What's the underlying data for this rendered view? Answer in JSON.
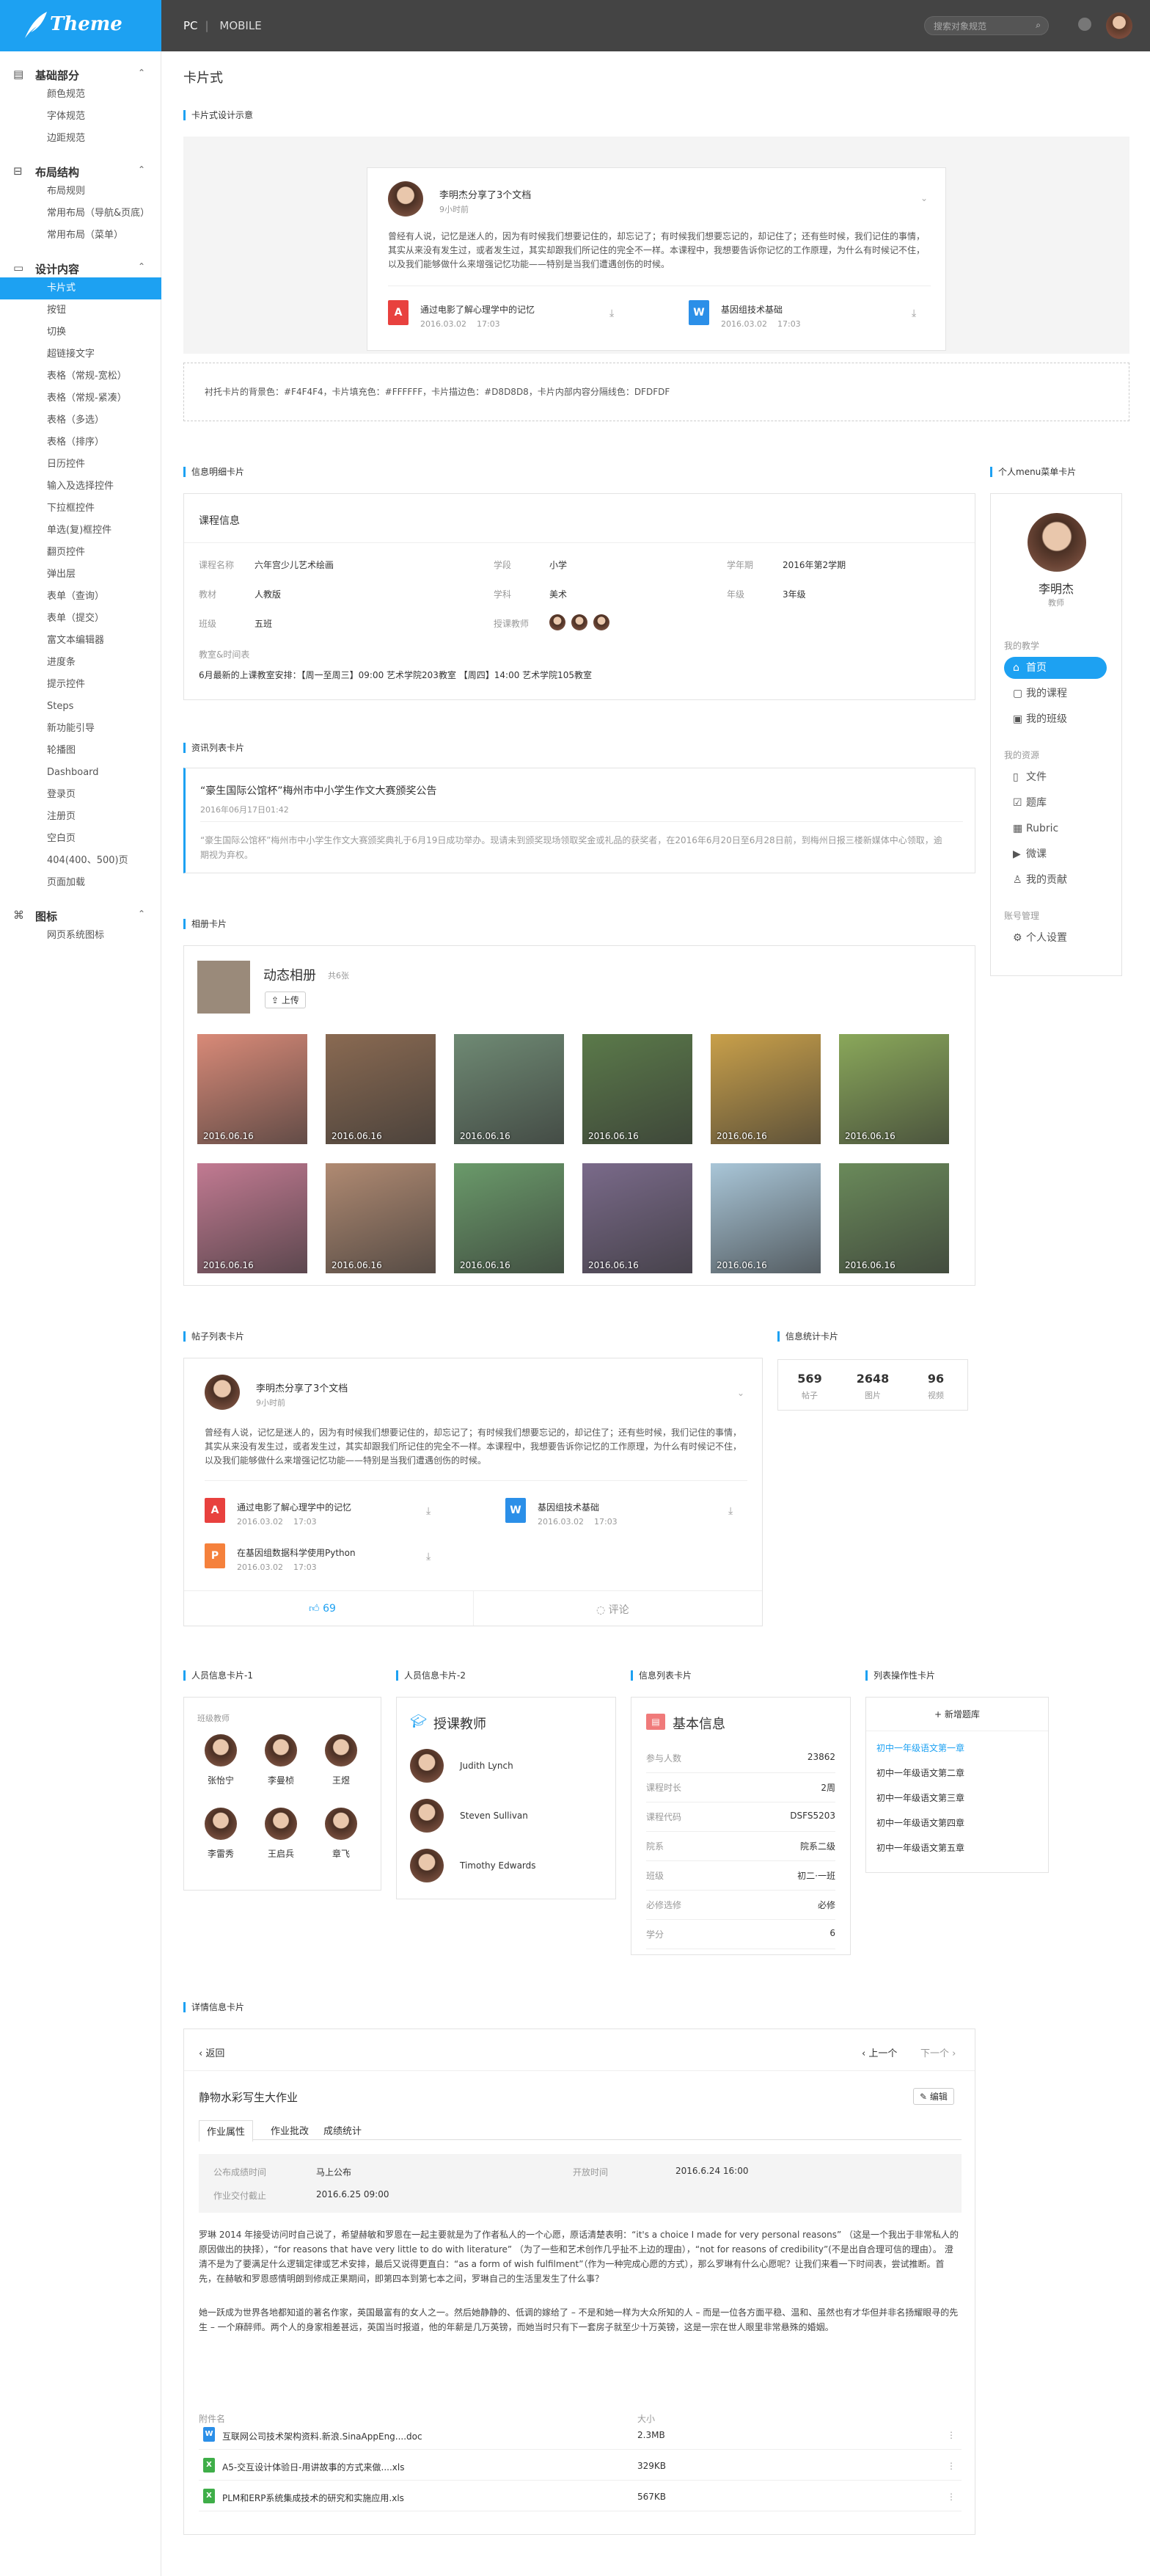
{
  "app": {
    "logo_text": "Theme",
    "nav_tabs": [
      "PC",
      "MOBILE"
    ],
    "search_placeholder": "搜索对象规范",
    "search_icon": "search-icon",
    "accent": "#1da1f2"
  },
  "sidebar": {
    "groups": [
      {
        "label": "基础部分",
        "icon": "basics-icon",
        "items": [
          "颜色规范",
          "字体规范",
          "边距规范"
        ]
      },
      {
        "label": "布局结构",
        "icon": "layout-icon",
        "items": [
          "布局规则",
          "常用布局（导航&页底）",
          "常用布局（菜单）"
        ]
      },
      {
        "label": "设计内容",
        "icon": "design-icon",
        "items": [
          "卡片式",
          "按钮",
          "切换",
          "超链接文字",
          "表格（常规-宽松）",
          "表格（常规-紧凑）",
          "表格（多选）",
          "表格（排序）",
          "日历控件",
          "输入及选择控件",
          "下拉框控件",
          "单选(复)框控件",
          "翻页控件",
          "弹出层",
          "表单（查询）",
          "表单（提交）",
          "富文本编辑器",
          "进度条",
          "提示控件",
          "Steps",
          "新功能引导",
          "轮播图",
          "Dashboard",
          "登录页",
          "注册页",
          "空白页",
          "404(400、500)页",
          "页面加载"
        ]
      },
      {
        "label": "图标",
        "icon": "icons-icon",
        "items": [
          "网页系统图标"
        ]
      }
    ],
    "active_item": "卡片式"
  },
  "page": {
    "title": "卡片式"
  },
  "demo": {
    "section": "卡片式设计示意",
    "post_author": "李明杰分享了3个文档",
    "post_time": "9小时前",
    "post_body": "曾经有人说，记忆是迷人的，因为有时候我们想要记住的，却忘记了；有时候我们想要忘记的，却记住了；还有些时候，我们记住的事情，其实从来没有发生过，或者发生过，其实却跟我们所记住的完全不一样。本课程中，我想要告诉你记忆的工作原理，为什么有时候记不住，以及我们能够做什么来增强记忆功能——特别是当我们遭遇创伤的时候。",
    "files": [
      {
        "name": "通过电影了解心理学中的记忆",
        "date": "2016.03.02",
        "time": "17:03",
        "type": "pdf"
      },
      {
        "name": "基因组技术基础",
        "date": "2016.03.02",
        "time": "17:03",
        "type": "word"
      }
    ],
    "note": "衬托卡片的背景色：#F4F4F4，卡片填充色：#FFFFFF，卡片描边色：#D8D8D8，卡片内部内容分隔线色：DFDFDF"
  },
  "info_card": {
    "section": "信息明细卡片",
    "title": "课程信息",
    "fields": [
      {
        "k": "课程名称",
        "v": "六年宫少儿艺术绘画"
      },
      {
        "k": "学段",
        "v": "小学"
      },
      {
        "k": "学年期",
        "v": "2016年第2学期"
      },
      {
        "k": "教材",
        "v": "人教版"
      },
      {
        "k": "学科",
        "v": "美术"
      },
      {
        "k": "年级",
        "v": "3年级"
      },
      {
        "k": "班级",
        "v": "五班"
      },
      {
        "k": "授课教师",
        "v": ""
      }
    ],
    "schedule_label": "教室&时间表",
    "schedule": "6月最新的上课教室安排：【周一至周三】09:00 艺术学院203教室    【周四】14:00 艺术学院105教室"
  },
  "news_card": {
    "section": "资讯列表卡片",
    "title": "“豪生国际公馆杯”梅州市中小学生作文大赛颁奖公告",
    "time": "2016年06月17日01:42",
    "body": "“豪生国际公馆杯”梅州市中小学生作文大赛颁奖典礼于6月19日成功举办。现请未到颁奖现场领取奖金或礼品的获奖者，在2016年6月20日至6月28日前，到梅州日报三楼新媒体中心领取，逾期视为弃权。"
  },
  "profile_card": {
    "section": "个人menu菜单卡片",
    "name": "李明杰",
    "role": "教师",
    "groups": [
      {
        "title": "我的教学",
        "items": [
          {
            "label": "首页",
            "icon": "home-icon"
          },
          {
            "label": "我的课程",
            "icon": "course-icon"
          },
          {
            "label": "我的班级",
            "icon": "class-icon"
          }
        ]
      },
      {
        "title": "我的资源",
        "items": [
          {
            "label": "文件",
            "icon": "file-icon"
          },
          {
            "label": "题库",
            "icon": "question-bank-icon"
          },
          {
            "label": "Rubric",
            "icon": "rubric-icon"
          },
          {
            "label": "微课",
            "icon": "microcourse-icon"
          },
          {
            "label": "我的贡献",
            "icon": "contribution-icon"
          }
        ]
      },
      {
        "title": "账号管理",
        "items": [
          {
            "label": "个人设置",
            "icon": "settings-icon"
          }
        ]
      }
    ]
  },
  "album": {
    "section": "相册卡片",
    "title": "动态相册",
    "count": "共6张",
    "upload": "上传",
    "photos": [
      "2016.06.16",
      "2016.06.16",
      "2016.06.16",
      "2016.06.16",
      "2016.06.16",
      "2016.06.16",
      "2016.06.16",
      "2016.06.16",
      "2016.06.16",
      "2016.06.16",
      "2016.06.16",
      "2016.06.16"
    ],
    "photo_colors": [
      "#d98a78",
      "#8a6a52",
      "#6f8a74",
      "#5b7a4a",
      "#c9a04a",
      "#8aa85a",
      "#c27a92",
      "#b08a72",
      "#6a9a6a",
      "#7a6a8a",
      "#a9c6d8",
      "#6a8a5a"
    ]
  },
  "post_list": {
    "section": "帖子列表卡片",
    "author": "李明杰分享了3个文档",
    "time": "9小时前",
    "body": "曾经有人说，记忆是迷人的，因为有时候我们想要记住的，却忘记了；有时候我们想要忘记的，却记住了；还有些时候，我们记住的事情，其实从来没有发生过，或者发生过，其实却跟我们所记住的完全不一样。本课程中，我想要告诉你记忆的工作原理，为什么有时候记不住，以及我们能够做什么来增强记忆功能——特别是当我们遭遇创伤的时候。",
    "files": [
      {
        "name": "通过电影了解心理学中的记忆",
        "date": "2016.03.02",
        "time": "17:03",
        "type": "pdf"
      },
      {
        "name": "基因组技术基础",
        "date": "2016.03.02",
        "time": "17:03",
        "type": "word"
      },
      {
        "name": "在基因组数据科学使用Python",
        "date": "2016.03.02",
        "time": "17:03",
        "type": "ppt"
      }
    ],
    "likes": "69",
    "comment": "评论"
  },
  "stats": {
    "section": "信息统计卡片",
    "items": [
      {
        "v": "569",
        "k": "帖子"
      },
      {
        "v": "2648",
        "k": "图片"
      },
      {
        "v": "96",
        "k": "视频"
      }
    ]
  },
  "person1": {
    "section": "人员信息卡片-1",
    "title": "班级教师",
    "people": [
      "张怡宁",
      "李曼桢",
      "王煜",
      "李雷秀",
      "王启兵",
      "章飞"
    ]
  },
  "person2": {
    "section": "人员信息卡片-2",
    "title": "授课教师",
    "people": [
      "Judith Lynch",
      "Steven Sullivan",
      "Timothy Edwards"
    ]
  },
  "info_list": {
    "section": "信息列表卡片",
    "title": "基本信息",
    "rows": [
      {
        "k": "参与人数",
        "v": "23862"
      },
      {
        "k": "课程时长",
        "v": "2周"
      },
      {
        "k": "课程代码",
        "v": "DSFS5203"
      },
      {
        "k": "院系",
        "v": "院系二级"
      },
      {
        "k": "班级",
        "v": "初二·一班"
      },
      {
        "k": "必修选修",
        "v": "必修"
      },
      {
        "k": "学分",
        "v": "6"
      }
    ]
  },
  "list_ops": {
    "section": "列表操作性卡片",
    "add": "新增题库",
    "items": [
      "初中一年级语文第一章",
      "初中一年级语文第二章",
      "初中一年级语文第三章",
      "初中一年级语文第四章",
      "初中一年级语文第五章"
    ]
  },
  "detail": {
    "section": "详情信息卡片",
    "back": "返回",
    "prev": "上一个",
    "next": "下一个",
    "title": "静物水彩写生大作业",
    "edit": "编辑",
    "tabs": [
      "作业属性",
      "作业批改",
      "成绩统计"
    ],
    "props": [
      {
        "k": "公布成绩时间",
        "v": "马上公布"
      },
      {
        "k": "开放时间",
        "v": "2016.6.24 16:00"
      },
      {
        "k": "作业交付截止",
        "v": "2016.6.25 09:00"
      }
    ],
    "para1": "罗琳 2014 年接受访问时自己说了，希望赫敏和罗恩在一起主要就是为了作者私人的一个心愿，原话清楚表明：“it's a choice I made for very personal reasons” （这是一个我出于非常私人的原因做出的抉择），“for reasons that have very little to do with literature” （为了一些和艺术创作几乎扯不上边的理由），“not for reasons of credibility”(不是出自合理可信的理由）。 澄清不是为了要满足什么逻辑定律或艺术安排，最后又说得更直白：“as a form of wish fulfilment”（作为一种完成心愿的方式），那么罗琳有什么心愿呢？让我们来看一下时间表，尝试推断。首先，在赫敏和罗恩感情明朗到修成正果期间，即第四本到第七本之间，罗琳自己的生活里发生了什么事？",
    "para2": "她一跃成为世界各地都知道的著名作家，英国最富有的女人之一。然后她静静的、低调的嫁给了 – 不是和她一样为大众所知的人 – 而是一位各方面平稳、温和、虽然也有才华但并非名扬耀眼寻的先生 – 一个麻醉师。两个人的身家相差甚远，英国当时报道，他的年薪是几万英镑，而她当时只有下一套房子就至少十万英镑，这是一宗在世人眼里非常悬殊的婚姻。",
    "attach_label": "附件名",
    "size_label": "大小",
    "attachments": [
      {
        "name": "互联网公司技术架构资料.新浪.SinaAppEng....doc",
        "size": "2.3MB",
        "type": "word"
      },
      {
        "name": "A5-交互设计体验日-用讲故事的方式来做....xls",
        "size": "329KB",
        "type": "xls"
      },
      {
        "name": "PLM和ERP系统集成技术的研究和实施应用.xls",
        "size": "567KB",
        "type": "xls"
      }
    ]
  }
}
